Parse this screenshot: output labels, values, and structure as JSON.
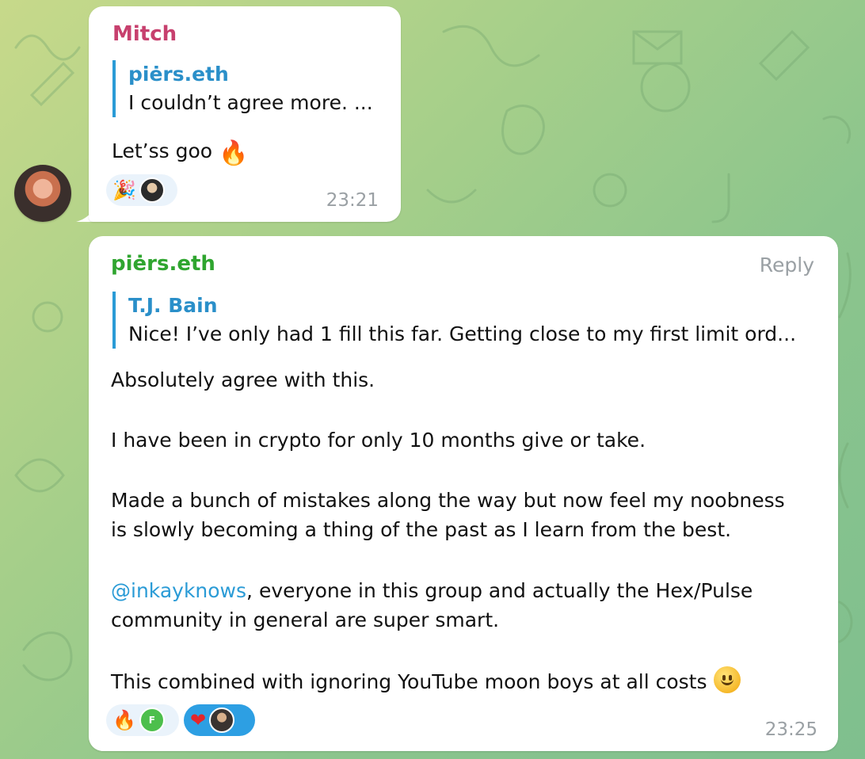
{
  "colors": {
    "mitch_name": "#c7406e",
    "piers_name": "#2fa52f",
    "quote_accent": "#2a9bd6",
    "link": "#2a9bd6",
    "reaction_active": "#2d9fe3"
  },
  "message1": {
    "sender": "Mitch",
    "reply_to": {
      "name": "piėrs.eth",
      "text": "I couldn’t agree more. ..."
    },
    "text": "Let’ss goo",
    "emoji": "🔥",
    "reactions": [
      {
        "emoji": "🎉",
        "icon": "party-popper-icon"
      }
    ],
    "time": "23:21"
  },
  "message2": {
    "sender": "piėrs.eth",
    "reply_action": "Reply",
    "reply_to": {
      "name": "T.J. Bain",
      "text": "Nice! I’ve only had 1 fill this far. Getting close to my first limit ord..."
    },
    "paragraphs": {
      "p1": "Absolutely agree with this.",
      "p2": "I have been in crypto for only 10 months give or take.",
      "p3a": "Made a bunch of mistakes along the way but now feel my noobness",
      "p3b": "is slowly becoming a thing of the past as I learn from the best.",
      "p4_mention": "@inkayknows",
      "p4a": ", everyone in this group and actually the Hex/Pulse",
      "p4b": "community in general are super smart.",
      "p5": "This combined with ignoring YouTube moon boys at all costs"
    },
    "reactions": [
      {
        "emoji": "🔥",
        "icon": "fire-icon",
        "avatar_letter": "F"
      },
      {
        "emoji": "❤",
        "icon": "heart-icon"
      }
    ],
    "time": "23:25"
  }
}
